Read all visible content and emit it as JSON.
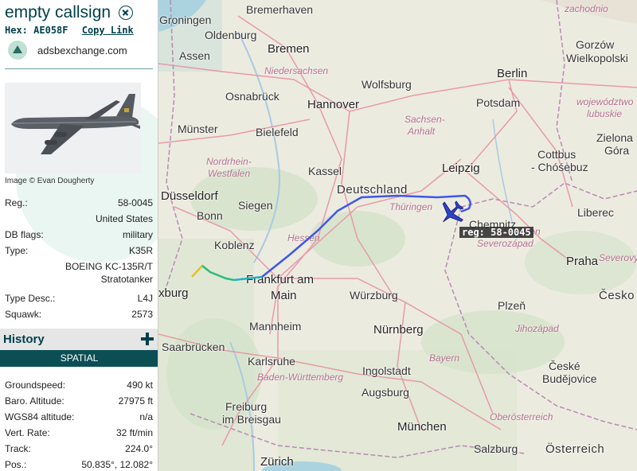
{
  "aircraft": {
    "callsign": "empty callsign",
    "hex_label": "Hex:",
    "hex": "AE058F",
    "copy_link": "Copy Link",
    "site": "adsbexchange.com",
    "photo_credit": "Image © Evan Dougherty"
  },
  "details": [
    {
      "key": "Reg.:",
      "value": "58-0045"
    },
    {
      "key": "",
      "value": "United States"
    },
    {
      "key": "DB flags:",
      "value": "military"
    },
    {
      "key": "Type:",
      "value": "K35R"
    },
    {
      "key": "",
      "value": "BOEING KC-135R/T"
    },
    {
      "key": "",
      "value": "Stratotanker"
    },
    {
      "key": "Type Desc.:",
      "value": "L4J"
    },
    {
      "key": "Squawk:",
      "value": "2573"
    }
  ],
  "history": {
    "title": "History",
    "spatial": "SPATIAL"
  },
  "spatial": [
    {
      "key": "Groundspeed:",
      "value": "490 kt"
    },
    {
      "key": "Baro. Altitude:",
      "value": "27975 ft"
    },
    {
      "key": "WGS84 altitude:",
      "value": "n/a"
    },
    {
      "key": "Vert. Rate:",
      "value": "32 ft/min"
    },
    {
      "key": "Track:",
      "value": "224.0°"
    },
    {
      "key": "Pos.:",
      "value": "50.835°, 12.082°"
    }
  ],
  "map": {
    "plane_label": "reg: 58-0045",
    "cities": {
      "groningen": "Groningen",
      "bremerhaven": "Bremerhaven",
      "oldenburg": "Oldenburg",
      "bremen": "Bremen",
      "assen": "Assen",
      "hamburg_region": "Niedersachsen",
      "wolfsburg": "Wolfsburg",
      "berlin": "Berlin",
      "osnabrueck": "Osnabrück",
      "hannover": "Hannover",
      "potsdam": "Potsdam",
      "muenster": "Münster",
      "bielefeld": "Bielefeld",
      "sachsen_anhalt_1": "Sachsen-",
      "sachsen_anhalt_2": "Anhalt",
      "cottbus": "Cottbus",
      "chosebuz": "- Chóśebuz",
      "nrw_1": "Nordrhein-",
      "nrw_2": "Westfalen",
      "kassel": "Kassel",
      "leipzig": "Leipzig",
      "duesseldorf": "Düsseldorf",
      "deutschland": "Deutschland",
      "siegen": "Siegen",
      "bonn": "Bonn",
      "thueringen": "Thüringen",
      "chemnitz": "Chemnitz",
      "sachsen": "Sachsen",
      "liberec": "Liberec",
      "koblenz": "Koblenz",
      "hessen": "Hessen",
      "severozapad": "Severozápad",
      "frankfurt_1": "Frankfurt am",
      "frankfurt_2": "Main",
      "praha": "Praha",
      "luxembourg": "xburg",
      "wuerzburg": "Würzburg",
      "plzen": "Plzeň",
      "mannheim": "Mannheim",
      "nuernberg": "Nürnberg",
      "jihozapad": "Jihozápad",
      "saarbruecken": "Saarbrücken",
      "bayern": "Bayern",
      "karlsruhe": "Karlsruhe",
      "bw": "Baden-Württemberg",
      "ingolstadt": "Ingolstadt",
      "ceske_1": "České",
      "ceske_2": "Budějovice",
      "augsburg": "Augsburg",
      "freiburg_1": "Freiburg",
      "freiburg_2": "im Breisgau",
      "muenchen": "München",
      "oberoesterreich": "Oberösterreich",
      "salzburg": "Salzburg",
      "oesterreich": "Österreich",
      "zuerich": "Zürich",
      "gorzow_1": "Gorzów",
      "gorzow_2": "Wielkopolski",
      "lubuskie_1": "województwo",
      "lubuskie_2": "lubuskie",
      "zielona_1": "Zielona",
      "zielona_2": "Góra",
      "cesko": "Česko",
      "severo": "Severový",
      "szczecin": "zachodnio"
    }
  },
  "colors": {
    "accent": "#003f4b",
    "spatial_bar": "#0b4f55",
    "track_blue": "#3f57e8",
    "track_green": "#2bbd7e",
    "track_yellow": "#e3c22b"
  }
}
